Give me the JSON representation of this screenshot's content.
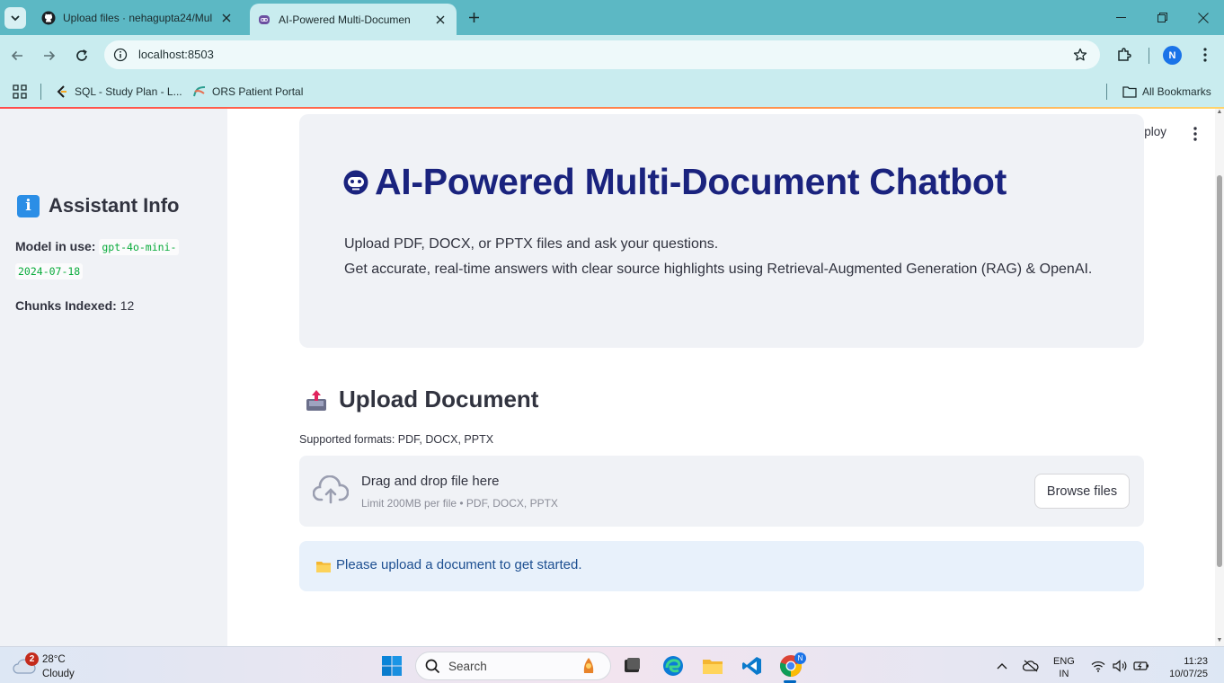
{
  "browser": {
    "tabs": [
      {
        "title": "Upload files · nehagupta24/Mul",
        "active": false
      },
      {
        "title": "AI-Powered Multi-Documen",
        "active": true
      }
    ],
    "url": "localhost:8503",
    "profile_initial": "N",
    "bookmarks": [
      {
        "label": "SQL - Study Plan - L..."
      },
      {
        "label": "ORS Patient Portal"
      }
    ],
    "all_bookmarks_label": "All Bookmarks"
  },
  "app": {
    "deploy_label": "Deploy",
    "sidebar": {
      "title": "Assistant Info",
      "model_label": "Model in use:",
      "model_value_line1": "gpt-4o-mini-",
      "model_value_line2": "2024-07-18",
      "chunks_label": "Chunks Indexed:",
      "chunks_value": "12"
    },
    "hero": {
      "title": "AI-Powered Multi-Document Chatbot",
      "line1": "Upload PDF, DOCX, or PPTX files and ask your questions.",
      "line2": "Get accurate, real-time answers with clear source highlights using Retrieval-Augmented Generation (RAG) & OpenAI."
    },
    "upload": {
      "heading": "Upload Document",
      "formats": "Supported formats: PDF, DOCX, PPTX",
      "drop_main": "Drag and drop file here",
      "drop_sub": "Limit 200MB per file • PDF, DOCX, PPTX",
      "browse_label": "Browse files"
    },
    "notice": "Please upload a document to get started."
  },
  "taskbar": {
    "weather_badge": "2",
    "temperature": "28°C",
    "condition": "Cloudy",
    "search_placeholder": "Search",
    "chrome_badge": "N",
    "lang_line1": "ENG",
    "lang_line2": "IN",
    "time": "11:23",
    "date": "10/07/25"
  },
  "colors": {
    "accent_title": "#1a237e",
    "sidebar_bg": "#f0f2f6",
    "code_green": "#09ab3b",
    "notice_bg": "#e8f1fb",
    "chrome_teal": "#5cb8c4"
  }
}
